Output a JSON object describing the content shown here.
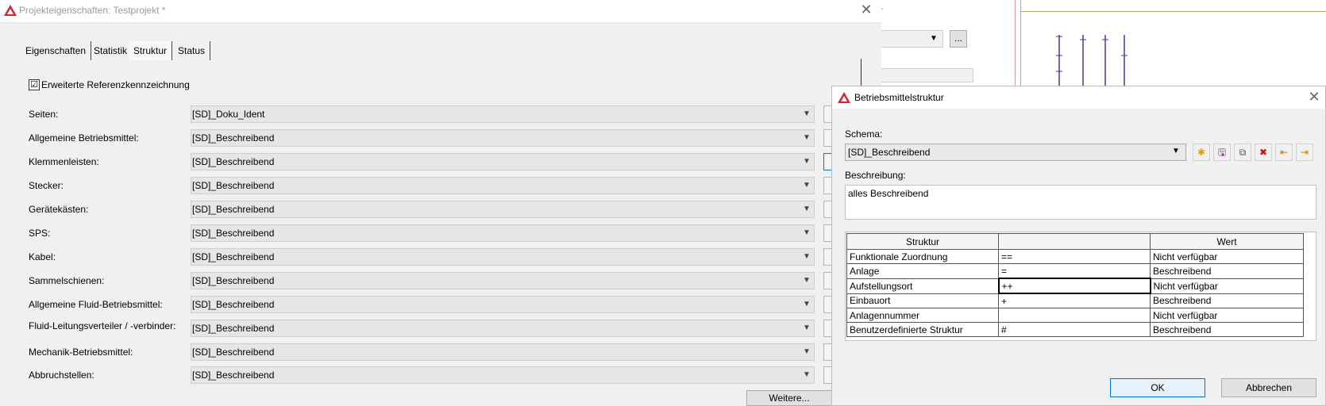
{
  "project_dialog": {
    "title": "Projekteigenschaften: Testprojekt *",
    "tabs": [
      "Eigenschaften",
      "Statistik",
      "Struktur",
      "Status"
    ],
    "active_tab": "Struktur",
    "extended_checkbox": {
      "label": "Erweiterte Referenzkennzeichnung",
      "checked": "☑"
    },
    "rows": [
      {
        "label": "Seiten:",
        "value": "[SD]_Doku_Ident"
      },
      {
        "label": "Allgemeine Betriebsmittel:",
        "value": "[SD]_Beschreibend"
      },
      {
        "label": "Klemmenleisten:",
        "value": "[SD]_Beschreibend"
      },
      {
        "label": "Stecker:",
        "value": "[SD]_Beschreibend"
      },
      {
        "label": "Gerätekästen:",
        "value": "[SD]_Beschreibend"
      },
      {
        "label": "SPS:",
        "value": "[SD]_Beschreibend"
      },
      {
        "label": "Kabel:",
        "value": "[SD]_Beschreibend"
      },
      {
        "label": "Sammelschienen:",
        "value": "[SD]_Beschreibend"
      },
      {
        "label": "Allgemeine Fluid-Betriebsmittel:",
        "value": "[SD]_Beschreibend"
      },
      {
        "label": "Fluid-Leitungsverteiler / -verbinder:",
        "value": "[SD]_Beschreibend"
      },
      {
        "label": "Mechanik-Betriebsmittel:",
        "value": "[SD]_Beschreibend"
      },
      {
        "label": "Abbruchstellen:",
        "value": "[SD]_Beschreibend"
      }
    ],
    "more_button": "Weitere..."
  },
  "bg_pane": {
    "ellipsis_button": "..."
  },
  "bms_dialog": {
    "title": "Betriebsmittelstruktur",
    "schema_label": "Schema:",
    "schema_value": "[SD]_Beschreibend",
    "description_label": "Beschreibung:",
    "description_value": "alles Beschreibend",
    "table": {
      "headers": [
        "Struktur",
        "",
        "Wert"
      ],
      "rows": [
        [
          "Funktionale Zuordnung",
          "==",
          "Nicht verfügbar"
        ],
        [
          "Anlage",
          "=",
          "Beschreibend"
        ],
        [
          "Aufstellungsort",
          "++",
          "Nicht verfügbar"
        ],
        [
          "Einbauort",
          "+",
          "Beschreibend"
        ],
        [
          "Anlagennummer",
          "",
          "Nicht verfügbar"
        ],
        [
          "Benutzerdefinierte Struktur",
          "#",
          "Beschreibend"
        ]
      ]
    },
    "ok_button": "OK",
    "cancel_button": "Abbrechen"
  },
  "icons": {
    "app": "eplan-logo-icon",
    "close": "close-icon",
    "chevron": "chevron-down-icon",
    "new": "new-star-icon",
    "save": "save-icon",
    "copy": "copy-icon",
    "delete": "delete-icon",
    "import": "import-icon",
    "export": "export-icon"
  },
  "colors": {
    "accent": "#0078d7",
    "logo": "#d9232e"
  }
}
